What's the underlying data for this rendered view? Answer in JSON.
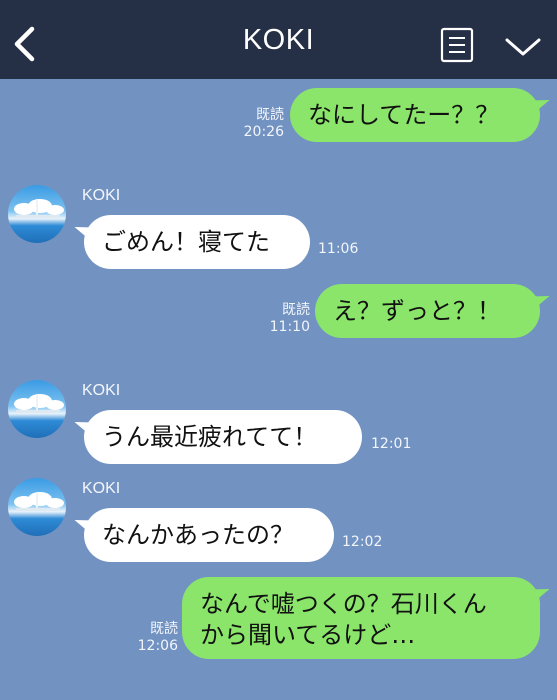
{
  "header": {
    "title": "KOKI",
    "icons": [
      "back-icon",
      "notes-icon",
      "chevron-down-icon"
    ]
  },
  "messages": [
    {
      "from": "me",
      "text_lines": [
        "なにしてたー？？"
      ],
      "read": "既読",
      "time": "20:26"
    },
    {
      "from": "them",
      "sender": "KOKI",
      "text_lines": [
        "ごめん！寝てた"
      ],
      "time": "11:06"
    },
    {
      "from": "me",
      "text_lines": [
        "え？ずっと？！"
      ],
      "read": "既読",
      "time": "11:10"
    },
    {
      "from": "them",
      "sender": "KOKI",
      "text_lines": [
        "うん最近疲れてて！"
      ],
      "time": "12:01"
    },
    {
      "from": "them",
      "sender": "KOKI",
      "text_lines": [
        "なんかあったの？"
      ],
      "time": "12:02"
    },
    {
      "from": "me",
      "text_lines": [
        "なんで嘘つくの？石川くん",
        "から聞いてるけど…"
      ],
      "read": "既読",
      "time": "12:06"
    }
  ],
  "colors": {
    "background": "#7293c2",
    "header": "#252f46",
    "my_bubble": "#8ae56a",
    "their_bubble": "#ffffff"
  }
}
